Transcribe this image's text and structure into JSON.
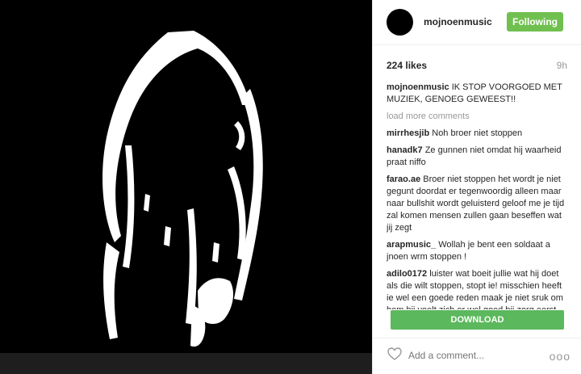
{
  "header": {
    "username": "mojnoenmusic",
    "follow_label": "Following"
  },
  "meta": {
    "likes": "224 likes",
    "time": "9h"
  },
  "caption": {
    "user": "mojnoenmusic",
    "text": "IK STOP VOORGOED MET MUZIEK, GENOEG GEWEEST!!"
  },
  "load_more": "load more comments",
  "comments": [
    {
      "user": "mirrhesjib",
      "text": "Noh broer niet stoppen"
    },
    {
      "user": "hanadk7",
      "text": "Ze gunnen niet omdat hij waarheid praat niffo"
    },
    {
      "user": "farao.ae",
      "text": "Broer niet stoppen het wordt je niet gegunt doordat er tegenwoordig alleen maar naar bullshit wordt geluisterd geloof me je tijd zal komen mensen zullen gaan beseffen wat jij zegt"
    },
    {
      "user": "arapmusic_",
      "text": "Wollah je bent een soldaat a jnoen wrm stoppen !"
    },
    {
      "user": "adilo0172",
      "text": "luister wat boeit jullie wat hij doet als die wilt stoppen, stopt ie! misschien heeft ie wel een goede reden maak je niet sruk om hem hij voelt zich er wel goed bij zorg eerst dat je zelf het"
    }
  ],
  "download_label": "DOWNLOAD",
  "footer": {
    "add_comment_placeholder": "Add a comment...",
    "more_label": "ooo"
  },
  "icons": {
    "heart": "heart-icon",
    "more": "more-options-icon"
  }
}
